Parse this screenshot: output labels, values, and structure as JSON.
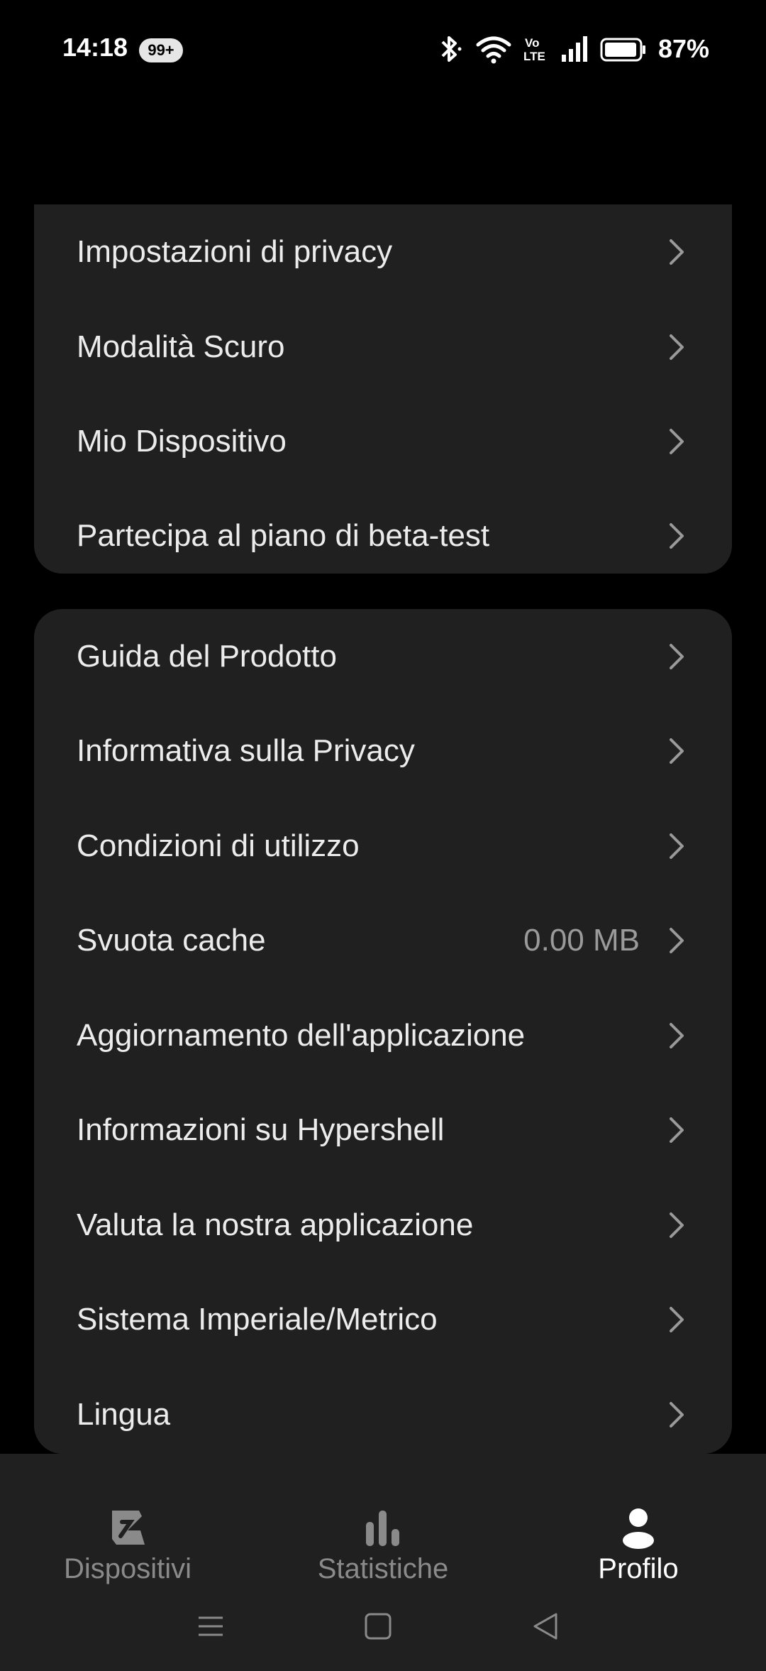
{
  "status_bar": {
    "time": "14:18",
    "notification_badge": "99+",
    "battery_percent": "87%",
    "icons": [
      "bluetooth-icon",
      "wifi-icon",
      "volte-icon",
      "signal-icon",
      "battery-icon"
    ]
  },
  "settings_group_1": {
    "items": [
      {
        "label": "Impostazioni di privacy"
      },
      {
        "label": "Modalità Scuro"
      },
      {
        "label": "Mio Dispositivo"
      },
      {
        "label": "Partecipa al piano di beta-test"
      }
    ]
  },
  "settings_group_2": {
    "items": [
      {
        "label": "Guida del Prodotto"
      },
      {
        "label": "Informativa sulla Privacy"
      },
      {
        "label": "Condizioni di utilizzo"
      },
      {
        "label": "Svuota cache",
        "value": "0.00 MB"
      },
      {
        "label": "Aggiornamento dell'applicazione"
      },
      {
        "label": "Informazioni su Hypershell"
      },
      {
        "label": "Valuta la nostra applicazione"
      },
      {
        "label": "Sistema Imperiale/Metrico"
      },
      {
        "label": "Lingua"
      }
    ]
  },
  "tab_bar": {
    "tabs": [
      {
        "label": "Dispositivi",
        "icon": "device-icon",
        "active": false
      },
      {
        "label": "Statistiche",
        "icon": "bar-chart-icon",
        "active": false
      },
      {
        "label": "Profilo",
        "icon": "person-icon",
        "active": true
      }
    ]
  },
  "colors": {
    "background": "#000000",
    "card": "#202020",
    "text": "#ececec",
    "muted": "#8a8a8a"
  }
}
